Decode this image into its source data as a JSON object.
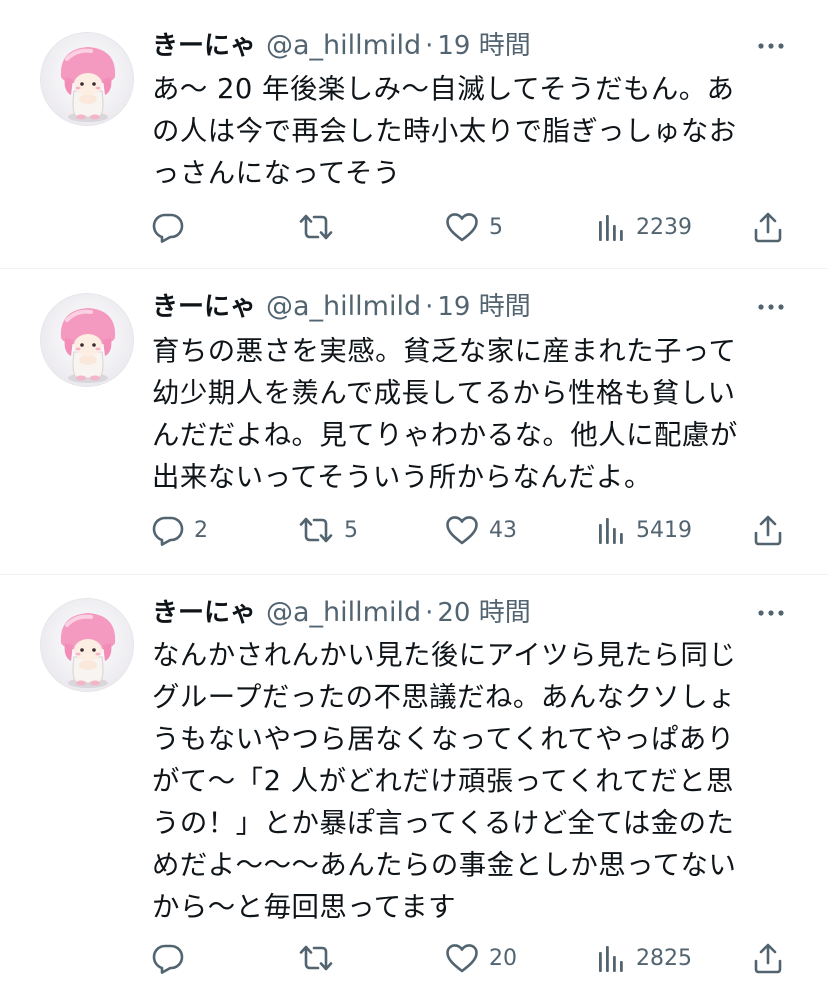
{
  "colors": {
    "text": "#0f1419",
    "secondary": "#536471",
    "divider": "#eff3f4",
    "avatar_pink": "#f7a4c5"
  },
  "tweets": [
    {
      "name": "きーにゃ",
      "handle": "@a_hillmild",
      "separator": "·",
      "time": "19 時間",
      "text": "あ〜 20 年後楽しみ〜自滅してそうだもん。あ\nの人は今で再会した時小太りで脂ぎっしゅなお\nっさんになってそう",
      "replies": "",
      "retweets": "",
      "likes": "5",
      "views": "2239",
      "icons": [
        "avatar-icon",
        "more-icon",
        "reply-icon",
        "retweet-icon",
        "like-icon",
        "views-icon",
        "share-icon"
      ]
    },
    {
      "name": "きーにゃ",
      "handle": "@a_hillmild",
      "separator": "·",
      "time": "19 時間",
      "text": "育ちの悪さを実感。貧乏な家に産まれた子って\n幼少期人を羨んで成長してるから性格も貧しい\nんだだよね。見てりゃわかるな。他人に配慮が\n出来ないってそういう所からなんだよ。",
      "replies": "2",
      "retweets": "5",
      "likes": "43",
      "views": "5419",
      "icons": [
        "avatar-icon",
        "more-icon",
        "reply-icon",
        "retweet-icon",
        "like-icon",
        "views-icon",
        "share-icon"
      ]
    },
    {
      "name": "きーにゃ",
      "handle": "@a_hillmild",
      "separator": "·",
      "time": "20 時間",
      "text": "なんかされんかい見た後にアイツら見たら同じ\nグループだったの不思議だね。あんなクソしょ\nうもないやつら居なくなってくれてやっぱあり\nがて〜「2 人がどれだけ頑張ってくれてだと思\nうの！」とか暴ぽ言ってくるけど全ては金のた\nめだよ〜〜〜あんたらの事金としか思ってない\nから〜と毎回思ってます",
      "replies": "",
      "retweets": "",
      "likes": "20",
      "views": "2825",
      "icons": [
        "avatar-icon",
        "more-icon",
        "reply-icon",
        "retweet-icon",
        "like-icon",
        "views-icon",
        "share-icon"
      ]
    }
  ]
}
